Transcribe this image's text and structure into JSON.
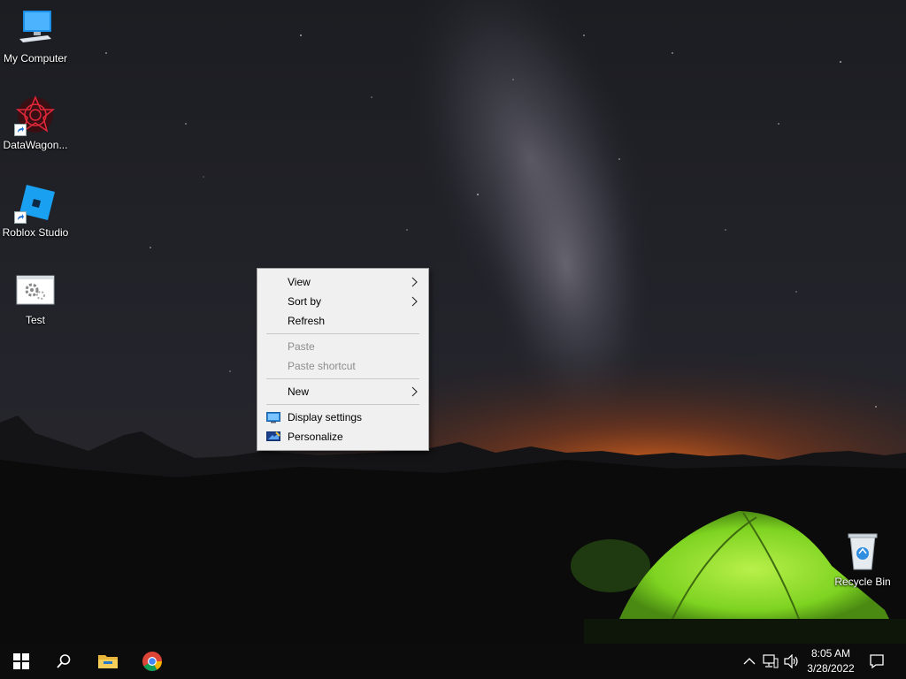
{
  "desktop": {
    "icons": [
      {
        "label": "My Computer",
        "icon": "monitor-icon"
      },
      {
        "label": "DataWagon...",
        "icon": "datawagon-icon"
      },
      {
        "label": "Roblox Studio",
        "icon": "roblox-studio-icon"
      },
      {
        "label": "Test",
        "icon": "settings-window-icon"
      },
      {
        "label": "Recycle Bin",
        "icon": "recycle-bin-icon"
      }
    ]
  },
  "context_menu": {
    "items": [
      {
        "label": "View",
        "submenu": true,
        "enabled": true
      },
      {
        "label": "Sort by",
        "submenu": true,
        "enabled": true
      },
      {
        "label": "Refresh",
        "submenu": false,
        "enabled": true
      },
      {
        "label": "Paste",
        "submenu": false,
        "enabled": false
      },
      {
        "label": "Paste shortcut",
        "submenu": false,
        "enabled": false
      },
      {
        "label": "New",
        "submenu": true,
        "enabled": true
      },
      {
        "label": "Display settings",
        "submenu": false,
        "enabled": true,
        "icon": "display-icon"
      },
      {
        "label": "Personalize",
        "submenu": false,
        "enabled": true,
        "icon": "personalize-icon"
      }
    ]
  },
  "taskbar": {
    "buttons": [
      "windows-start-icon",
      "search-icon",
      "file-explorer-icon",
      "chrome-icon"
    ],
    "tray": [
      "chevron-up-icon",
      "network-icon",
      "volume-icon"
    ],
    "time": "8:05 AM",
    "date": "3/28/2022",
    "notification_icon": "action-center-icon"
  },
  "colors": {
    "menu_bg": "#f0f0f0",
    "menu_disabled_text": "#8d8d8d",
    "taskbar_bg": "#0c0c0c",
    "tent_green": "#7ed321",
    "sunset_orange": "#e0661c"
  }
}
